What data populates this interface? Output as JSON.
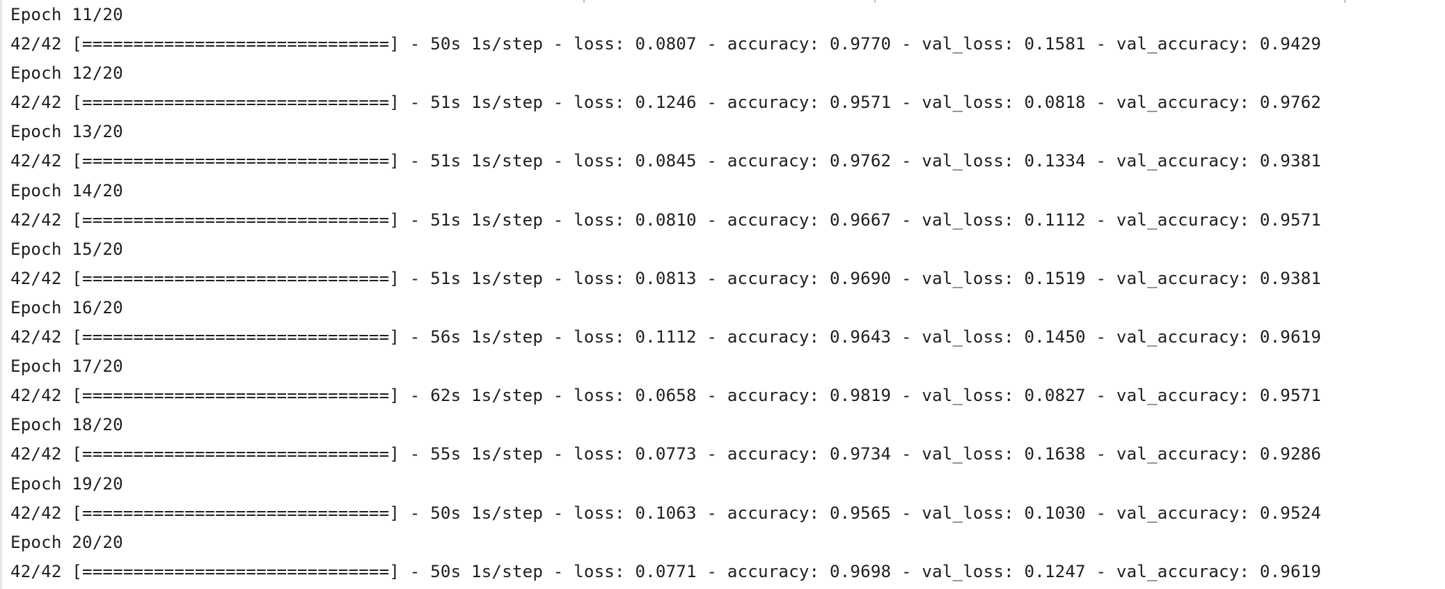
{
  "console": {
    "lines": [
      "Epoch 11/20",
      "42/42 [==============================] - 50s 1s/step - loss: 0.0807 - accuracy: 0.9770 - val_loss: 0.1581 - val_accuracy: 0.9429",
      "Epoch 12/20",
      "42/42 [==============================] - 51s 1s/step - loss: 0.1246 - accuracy: 0.9571 - val_loss: 0.0818 - val_accuracy: 0.9762",
      "Epoch 13/20",
      "42/42 [==============================] - 51s 1s/step - loss: 0.0845 - accuracy: 0.9762 - val_loss: 0.1334 - val_accuracy: 0.9381",
      "Epoch 14/20",
      "42/42 [==============================] - 51s 1s/step - loss: 0.0810 - accuracy: 0.9667 - val_loss: 0.1112 - val_accuracy: 0.9571",
      "Epoch 15/20",
      "42/42 [==============================] - 51s 1s/step - loss: 0.0813 - accuracy: 0.9690 - val_loss: 0.1519 - val_accuracy: 0.9381",
      "Epoch 16/20",
      "42/42 [==============================] - 56s 1s/step - loss: 0.1112 - accuracy: 0.9643 - val_loss: 0.1450 - val_accuracy: 0.9619",
      "Epoch 17/20",
      "42/42 [==============================] - 62s 1s/step - loss: 0.0658 - accuracy: 0.9819 - val_loss: 0.0827 - val_accuracy: 0.9571",
      "Epoch 18/20",
      "42/42 [==============================] - 55s 1s/step - loss: 0.0773 - accuracy: 0.9734 - val_loss: 0.1638 - val_accuracy: 0.9286",
      "Epoch 19/20",
      "42/42 [==============================] - 50s 1s/step - loss: 0.1063 - accuracy: 0.9565 - val_loss: 0.1030 - val_accuracy: 0.9524",
      "Epoch 20/20",
      "42/42 [==============================] - 50s 1s/step - loss: 0.0771 - accuracy: 0.9698 - val_loss: 0.1247 - val_accuracy: 0.9619"
    ]
  }
}
